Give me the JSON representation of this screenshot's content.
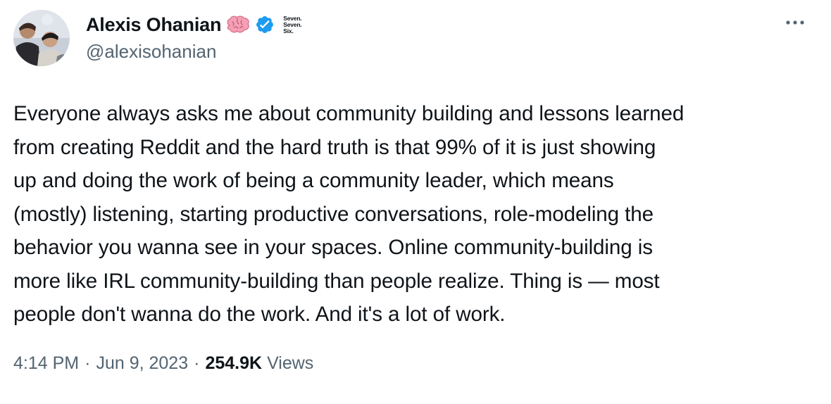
{
  "author": {
    "display_name": "Alexis Ohanian",
    "handle": "@alexisohanian",
    "emoji_icon": "brain-icon",
    "verified_icon": "verified-badge-icon",
    "affiliate_badge_lines": [
      "Seven.",
      "Seven.",
      "Six."
    ]
  },
  "tweet": {
    "text": "Everyone always asks me about community building and lessons learned\nfrom creating Reddit and the hard truth is that 99% of it is just showing\nup and doing the work of being a community leader, which means\n(mostly) listening, starting productive conversations, role-modeling the\nbehavior you wanna see in your spaces. Online community-building is\nmore like IRL community-building than people realize. Thing is — most\npeople don't wanna do the work. And it's a lot of work."
  },
  "meta": {
    "time": "4:14 PM",
    "separator": "·",
    "date": "Jun 9, 2023",
    "views_count": "254.9K",
    "views_label": "Views"
  },
  "colors": {
    "text_primary": "#0f1419",
    "text_secondary": "#536471",
    "verified_blue": "#1d9bf0"
  }
}
